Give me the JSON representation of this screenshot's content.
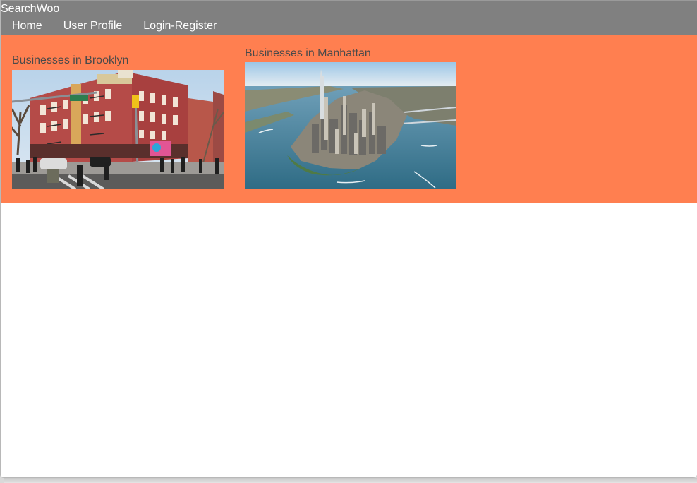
{
  "app": {
    "title": "SearchWoo"
  },
  "nav": {
    "items": [
      {
        "label": "Home"
      },
      {
        "label": "User Profile"
      },
      {
        "label": "Login-Register"
      }
    ]
  },
  "banner": {
    "background_color": "#ff7f50",
    "cards": [
      {
        "title": "Businesses in Brooklyn",
        "image": "brooklyn-street-photo"
      },
      {
        "title": "Businesses in Manhattan",
        "image": "manhattan-aerial-photo"
      }
    ]
  },
  "colors": {
    "header_bg": "#808080",
    "banner_bg": "#ff7f50",
    "card_title": "#4a4a4a"
  }
}
